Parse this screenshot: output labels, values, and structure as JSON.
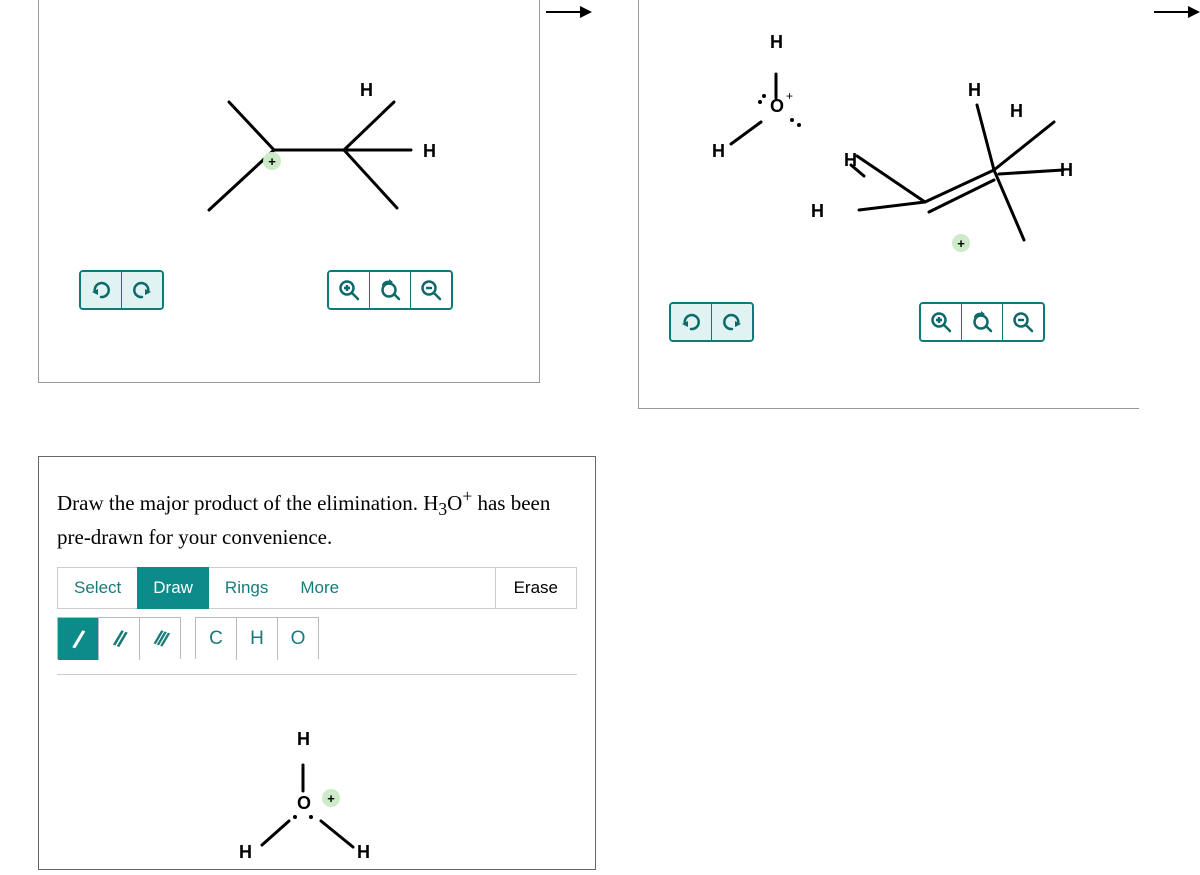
{
  "arrows": [
    "→",
    "→"
  ],
  "panels": {
    "left_structure": {
      "undo": "undo",
      "redo": "redo",
      "zoom_in": "zoom-in",
      "zoom_reset": "zoom-reset",
      "zoom_out": "zoom-out",
      "atoms": {
        "H_top": "H",
        "H_right": "H",
        "plus": "+"
      }
    },
    "right_structure": {
      "undo": "undo",
      "redo": "redo",
      "zoom_in": "zoom-in",
      "zoom_reset": "zoom-reset",
      "zoom_out": "zoom-out",
      "atoms": {
        "hydronium": {
          "H_top": "H",
          "O": "O",
          "H_left": "H",
          "plus": "+"
        },
        "alkene": {
          "H1": "H",
          "H2": "H",
          "H3": "H",
          "H4": "H",
          "H5": "H",
          "plus": "+"
        }
      }
    }
  },
  "question": {
    "prompt_html": "Draw the major product of the elimination. H<sub>3</sub>O<sup>+</sup> has been pre-drawn for your convenience.",
    "tabs": {
      "select": "Select",
      "draw": "Draw",
      "rings": "Rings",
      "more": "More",
      "erase": "Erase"
    },
    "tools": {
      "single": "/",
      "double": "//",
      "triple": "///",
      "C": "C",
      "H": "H",
      "O": "O"
    },
    "canvas": {
      "hydronium": {
        "H_top": "H",
        "O": "O",
        "H_left": "H",
        "H_right": "H",
        "plus": "+"
      }
    }
  }
}
